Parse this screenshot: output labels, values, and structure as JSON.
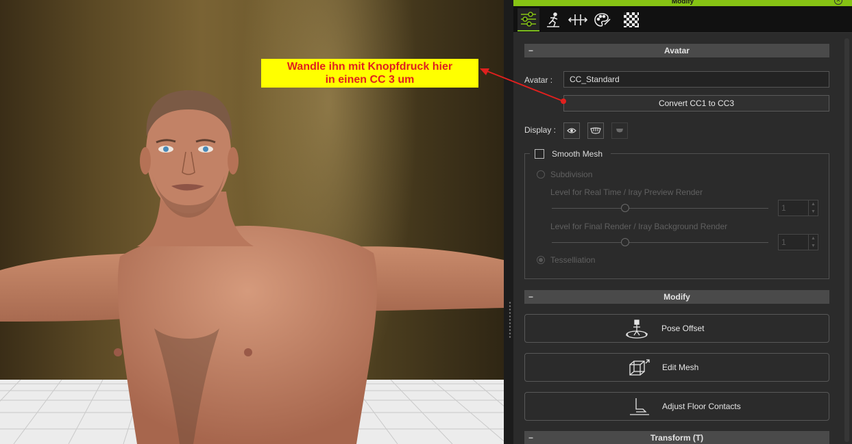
{
  "callout": {
    "line1": "Wandle ihn mit Knopfdruck hier",
    "line2": "in einen CC 3 um"
  },
  "panel": {
    "title": "Modify",
    "tabs": [
      {
        "icon": "modify-sliders-icon",
        "active": true
      },
      {
        "icon": "motion-pose-icon",
        "active": false
      },
      {
        "icon": "morph-slider-icon",
        "active": false
      },
      {
        "icon": "material-palette-icon",
        "active": false
      },
      {
        "icon": "texture-checker-icon",
        "active": false
      }
    ],
    "avatar_section": {
      "header": "Avatar",
      "avatar_label": "Avatar :",
      "avatar_value": "CC_Standard",
      "convert_button": "Convert CC1 to CC3",
      "display_label": "Display :"
    },
    "smooth_mesh": {
      "checkbox_label": "Smooth Mesh",
      "checked": false,
      "subdivision_label": "Subdivision",
      "realtime_label": "Level for Real Time / Iray Preview Render",
      "realtime_value": "1",
      "final_label": "Level for Final Render / Iray Background Render",
      "final_value": "1",
      "tessellation_label": "Tesselliation"
    },
    "modify_section": {
      "header": "Modify",
      "pose_offset": "Pose Offset",
      "edit_mesh": "Edit Mesh",
      "adjust_floor": "Adjust Floor Contacts"
    },
    "transform_section": {
      "header": "Transform  (T)"
    }
  },
  "colors": {
    "accent": "#86c314",
    "callout_bg": "#ffff00",
    "callout_text": "#e0201e",
    "arrow": "#e0201e"
  }
}
